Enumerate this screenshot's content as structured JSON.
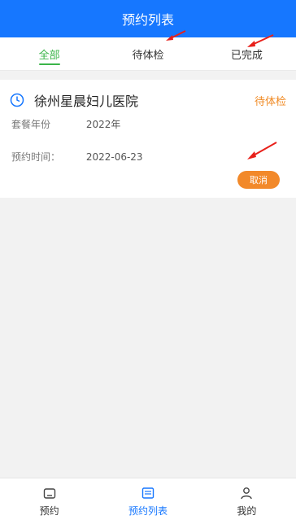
{
  "header": {
    "title": "预约列表"
  },
  "tabs": [
    {
      "label": "全部",
      "active": true
    },
    {
      "label": "待体检",
      "active": false
    },
    {
      "label": "已完成",
      "active": false
    }
  ],
  "card": {
    "hospital": "徐州星晨妇儿医院",
    "status": "待体检",
    "fields": [
      {
        "label": "套餐年份",
        "value": "2022年"
      },
      {
        "label": "预约时间：",
        "value": "2022-06-23"
      }
    ],
    "action_label": "取消",
    "icon": "clock-icon"
  },
  "bottom_nav": [
    {
      "label": "预约",
      "icon": "home-icon",
      "active": false
    },
    {
      "label": "预约列表",
      "icon": "list-icon",
      "active": true
    },
    {
      "label": "我的",
      "icon": "user-icon",
      "active": false
    }
  ],
  "colors": {
    "primary": "#1677ff",
    "tab_active": "#3bb54a",
    "status": "#f08a24",
    "button": "#f2892a",
    "annotation_arrow": "#e8201a"
  }
}
